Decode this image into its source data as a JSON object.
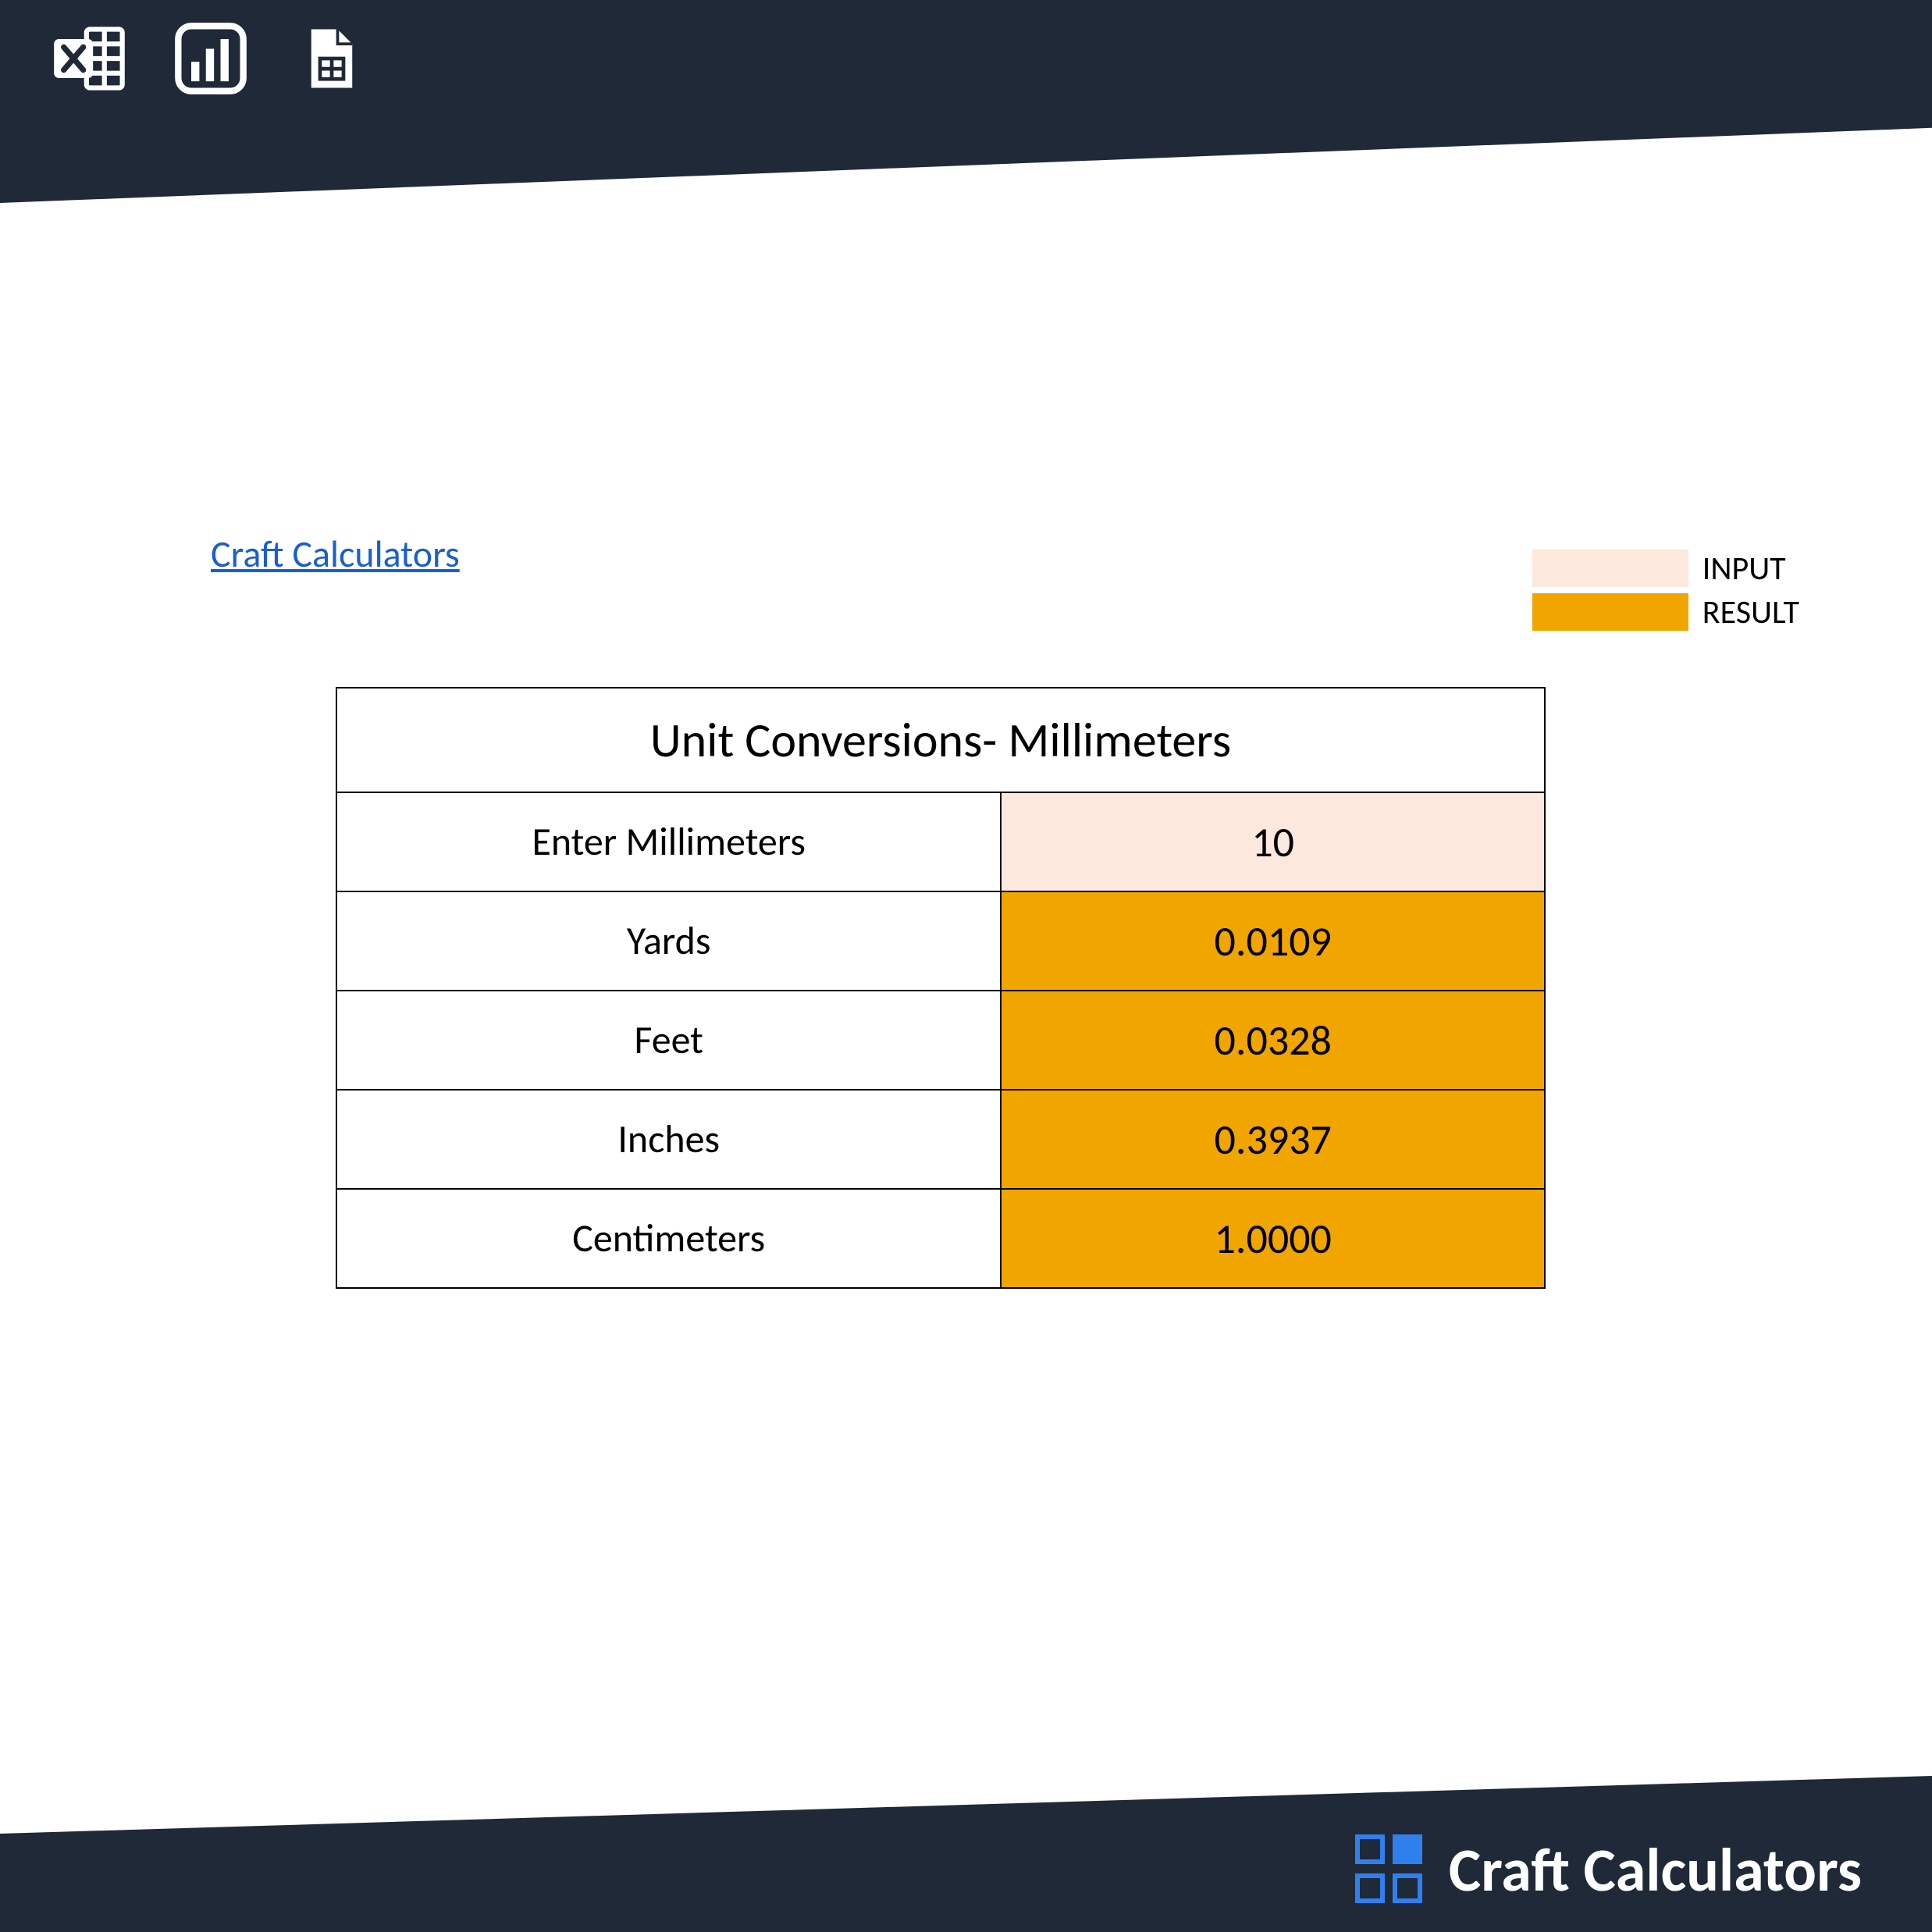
{
  "header_icons": [
    "excel-icon",
    "chart-icon",
    "sheets-icon"
  ],
  "link_text": "Craft Calculators",
  "legend": {
    "input_label": "INPUT",
    "result_label": "RESULT"
  },
  "colors": {
    "input_bg": "#fce8dd",
    "result_bg": "#f0a500",
    "bar_bg": "#1f2937",
    "link": "#1a5fce"
  },
  "table": {
    "title": "Unit Conversions- Millimeters",
    "input_row": {
      "label": "Enter Millimeters",
      "value": "10"
    },
    "result_rows": [
      {
        "label": "Yards",
        "value": "0.0109"
      },
      {
        "label": "Feet",
        "value": "0.0328"
      },
      {
        "label": "Inches",
        "value": "0.3937"
      },
      {
        "label": "Centimeters",
        "value": "1.0000"
      }
    ]
  },
  "footer_brand": "Craft Calculators"
}
